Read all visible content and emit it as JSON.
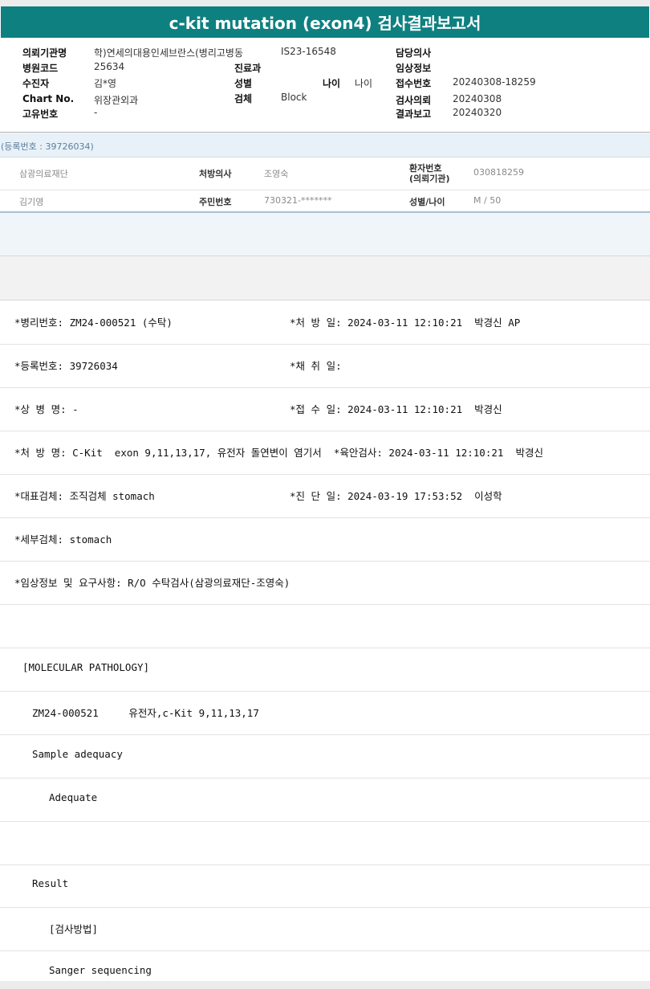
{
  "title": "c-kit mutation (exon4) 검사결과보고서",
  "header": {
    "col1": [
      {
        "label": "의뢰기관명",
        "value": "학)연세의대용인세브란스(병리고병동"
      },
      {
        "label": "병원코드",
        "value": "25634"
      },
      {
        "label": "수진자",
        "value": "김*영"
      },
      {
        "label": "Chart No.",
        "value": "위장관외과"
      },
      {
        "label": "고유번호",
        "value": "-"
      }
    ],
    "col2": [
      {
        "label": "IS23-16548",
        "value": ""
      },
      {
        "label": "진료과",
        "value": ""
      },
      {
        "label": "성별",
        "value": ""
      },
      {
        "label": "검체",
        "value": "Block"
      }
    ],
    "age_label": "나이",
    "age_value": "나이",
    "col3": [
      {
        "label": "담당의사",
        "value": ""
      },
      {
        "label": "임상정보",
        "value": ""
      },
      {
        "label": "접수번호",
        "value": "20240308-18259"
      },
      {
        "label": "검사의뢰",
        "value": "20240308"
      },
      {
        "label": "결과보고",
        "value": "20240320"
      }
    ]
  },
  "registration": "(등록번호 : 39726034)",
  "patient": {
    "row1": {
      "institution": "삼광의료재단",
      "doctor_label": "처방의사",
      "doctor": "조영숙",
      "patient_no_label": "환자번호\n(의뢰기관)",
      "patient_no": "030818259"
    },
    "row2": {
      "name": "김기영",
      "rrn_label": "주민번호",
      "rrn": "730321-*******",
      "sex_age_label": "성별/나이",
      "sex_age": "M / 50"
    }
  },
  "report": [
    {
      "left": "*병리번호: ZM24-000521 (수탁)",
      "right": "*처 방 일: 2024-03-11 12:10:21  박경신 AP"
    },
    {
      "left": "*등록번호: 39726034",
      "right": "*채 취 일:"
    },
    {
      "left": "*상 병 명: -",
      "right": "*접 수 일: 2024-03-11 12:10:21  박경신"
    },
    {
      "left": "*처 방 명: C-Kit  exon 9,11,13,17, 유전자 돌연변이 염기서  *육안검사: 2024-03-11 12:10:21  박경신",
      "right": ""
    },
    {
      "left": "*대표검체: 조직검체 stomach",
      "right": "*진 단 일: 2024-03-19 17:53:52  이성학"
    },
    {
      "left": "*세부검체: stomach",
      "right": ""
    },
    {
      "left": "*임상정보 및 요구사항: R/O 수탁검사(삼광의료재단-조영숙)",
      "right": ""
    },
    {
      "left": "",
      "right": ""
    },
    {
      "left": "[MOLECULAR PATHOLOGY]",
      "right": ""
    },
    {
      "left": "ZM24-000521     유전자,c-Kit 9,11,13,17",
      "right": ""
    },
    {
      "left": "Sample adequacy",
      "right": ""
    },
    {
      "left": "Adequate",
      "right": ""
    },
    {
      "left": "",
      "right": ""
    },
    {
      "left": "Result",
      "right": ""
    },
    {
      "left": "[검사방법]",
      "right": ""
    },
    {
      "left": "Sanger sequencing",
      "right": ""
    }
  ]
}
